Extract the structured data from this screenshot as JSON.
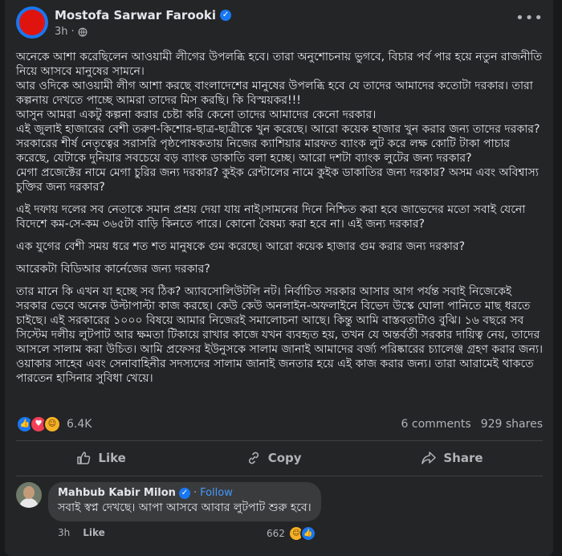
{
  "post": {
    "author": "Mostofa Sarwar Farooki",
    "time": "3h",
    "paragraphs": [
      [
        "অনেকে আশা করেছিলেন আওয়ামী লীগের উপলব্ধি হবে। তারা অনুশোচনায় ভুগবে, বিচার পর্ব পার হয়ে নতুন রাজনীতি নিয়ে আসবে মানুষের সামনে।",
        "আর ওদিকে আওয়ামী লীগ আশা করছে বাংলাদেশের মানুষের উপলব্ধি হবে যে তাদের আমাদের কতোটা দরকার। তারা কল্পনায় দেখতে পাচ্ছে আমরা তাদের মিস করছি। কি বিস্ময়কর!!!",
        "আসুন আমরা একটু কল্পনা করার চেষ্টা করি কেনো তাদের আমাদের কেনো দরকার।",
        "এই জুলাই হাজারের বেশী তরুণ-কিশোর-ছাত্র-ছাত্রীকে খুন করেছে। আরো কয়েক হাজার খুন করার জন্য তাদের দরকার?",
        "সরকারের শীর্ষ নেতৃত্বের সরাসরি পৃষ্ঠপোষকতায় নিজের ক্যাশিয়ার মারফত ব্যাংক লুট করে লক্ষ কোটি টাকা পাচার করেছে, যেটাকে দুনিয়ার সবচেয়ে বড় ব্যাংক ডাকাতি বলা হচ্ছে। আরো দশটা ব্যাংক লুটের জন্য দরকার?",
        "মেগা প্রজেক্টের নামে মেগা চুরির জন্য দরকার? কুইক রেন্টালের নামে কুইক ডাকাতির জন্য দরকার? অসম এবং অবিশ্বাস্য চুক্তির জন্য দরকার?"
      ],
      [
        "এই দফায় দলের সব নেতাকে সমান প্রশ্রয় দেয়া যায় নাই।সামনের দিনে নিশ্চিত করা হবে জাভেদের মতো সবাই যেনো বিদেশে কম-সে-কম ৩৬৫টা বাড়ি কিনতে পারে। কোনো বৈষম্য করা হবে না। এই জন্য দরকার?"
      ],
      [
        "এক যুগের বেশী সময় ধরে শত শত মানুষকে গুম করেছে। আরো কয়েক হাজার গুম করার জন্য দরকার?"
      ],
      [
        "আরেকটা বিডিআর কার্নেজের জন্য দরকার?"
      ],
      [
        "তার মানে কি এখন যা হচ্ছে সব ঠিক? অ্যাবসোলিউটলি নট। নির্বাচিত সরকার আসার আগ পর্যন্ত সবাই নিজেকেই সরকার ভেবে অনেক উল্টাপাল্টা কাজ করছে। কেউ কেউ অনলাইন-অফলাইনে বিভেদ উস্কে ঘোলা পানিতে মাছ ধরতে চাইছে। এই সরকারের ১০০০ বিষয়ে আমার নিজেরই সমালোচনা আছে। কিন্তু আমি বাস্তবতাটাও বুঝি। ১৬ বছরে সব সিস্টেম দলীয় লুটপাট আর ক্ষমতা টিকায়ে রাখার কাজে যখন ব্যবহৃত হয়, তখন যে অন্তর্বর্তী সরকার দায়িত্ব নেয়, তাদের আসলে সালাম করা উচিত। আমি প্রফেসর ইউনুসকে সালাম জানাই আমাদের বর্জ্য পরিষ্কারের চ্যালেঞ্জ গ্রহণ করার জন্য। ওয়াকার সাহেব এবং সেনাবাহিনীর সদস্যদের সালাম জানাই জনতার হয়ে এই কাজ করার জন্য। তারা আরামেই থাকতে পারতেন হাসিনার সুবিধা খেয়ে।"
      ]
    ]
  },
  "reactions": {
    "count": "6.4K",
    "comments": "6 comments",
    "shares": "929 shares"
  },
  "actions": {
    "like": "Like",
    "copy": "Copy",
    "share": "Share"
  },
  "comment": {
    "author": "Mahbub Kabir Milon",
    "follow": "Follow",
    "text": "সবাই স্বপ্ন দেখছে। আপা আসবে আবার লুটপাট শুরু হবে।",
    "time": "3h",
    "like": "Like",
    "reaction_count": "662"
  },
  "colors": {
    "bg": "#18191a",
    "card": "#242526",
    "accent": "#1877f2",
    "avatar_red": "#e0140f"
  },
  "icons": [
    "globe-icon",
    "verified-badge-icon",
    "more-options-icon",
    "like-reaction-icon",
    "love-reaction-icon",
    "haha-reaction-icon",
    "thumbs-up-icon",
    "copy-icon",
    "share-icon"
  ]
}
